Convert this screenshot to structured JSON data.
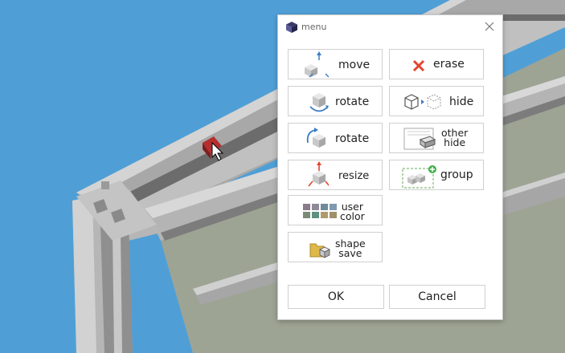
{
  "window": {
    "title": "menu",
    "app_icon": "cube-logo-icon",
    "close_icon": "close-icon"
  },
  "buttons": {
    "move": {
      "label": "move",
      "icon": "move-icon"
    },
    "erase": {
      "label": "erase",
      "icon": "erase-x-icon",
      "icon_color": "#e2452f"
    },
    "rotate1": {
      "label": "rotate",
      "icon": "rotate-horizontal-icon"
    },
    "hide": {
      "label": "hide",
      "icon": "hide-cube-icon"
    },
    "rotate2": {
      "label": "rotate",
      "icon": "rotate-vertical-icon"
    },
    "other_hide": {
      "line1": "other",
      "line2": "hide",
      "icon": "other-hide-icon"
    },
    "resize": {
      "label": "resize",
      "icon": "resize-icon"
    },
    "group": {
      "label": "group",
      "icon": "group-add-icon"
    },
    "user_color": {
      "line1": "user",
      "line2": "color",
      "icon": "color-palette-icon",
      "swatches": [
        "#8a7a8a",
        "#8e8a9a",
        "#6f8a9a",
        "#7f9ab0",
        "#7a8a74",
        "#5f8f80",
        "#b09a6a",
        "#a0906a"
      ]
    },
    "shape_save": {
      "line1": "shape",
      "line2": "save",
      "icon": "folder-save-icon"
    }
  },
  "footer": {
    "ok": "OK",
    "cancel": "Cancel"
  },
  "scene": {
    "background_color": "#4f9fd6",
    "wall_color": "#9ea494",
    "selected_block_color": "#b52e2e"
  }
}
